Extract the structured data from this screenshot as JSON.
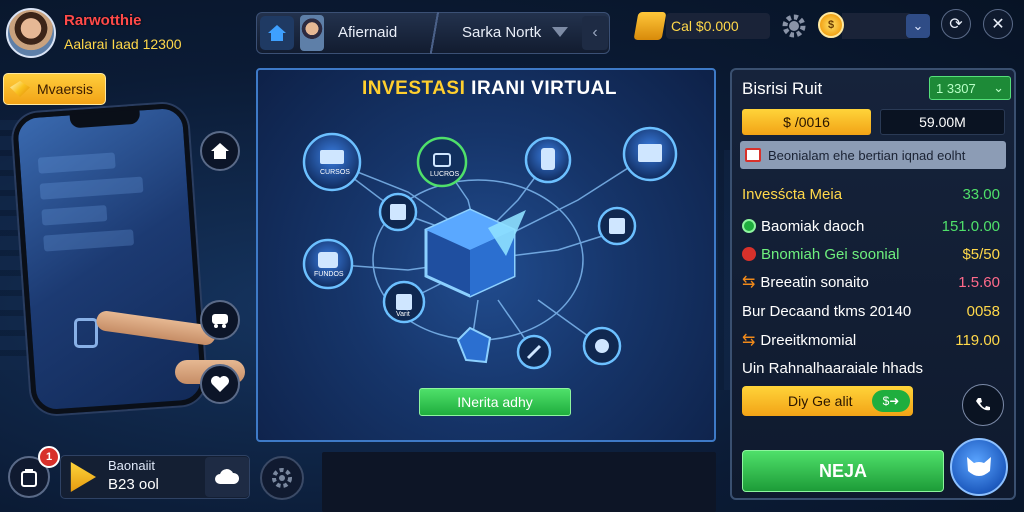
{
  "profile": {
    "name": "Rarwotthie",
    "sub": "Aalarai Iaad 12300"
  },
  "view_button": {
    "label": "Mvaersis"
  },
  "nav": {
    "tab1": "Afiernaid",
    "tab2": "Sarka Nortk"
  },
  "balance": {
    "label": "Cal $0.000"
  },
  "main": {
    "title_yellow": "INVESTASI",
    "title_white": "IRANI VIRTUAL",
    "nodes": {
      "n1": "CURSOS",
      "n2": "LUCROS",
      "n3": "FUNDOS",
      "center": "Varit"
    },
    "cta": "INerita adhy"
  },
  "right": {
    "title": "Bisrisi Ruit",
    "tag": "1 3307",
    "value_yellow": "$ /0016",
    "value_dark": "59.00M",
    "note": "Beonialam ehe bertian iqnad eolht",
    "rows": [
      {
        "label": "Invesścta Meia",
        "value": "33.00",
        "lcolor": "#ffd84a",
        "vcolor": "#4fe06a",
        "icon": "none"
      },
      {
        "label": "Baomiak daoch",
        "value": "151.0.00",
        "lcolor": "#ffffff",
        "vcolor": "#4fe06a",
        "icon": "green"
      },
      {
        "label": "Bnomiah Gei soonial",
        "value": "$5/50",
        "lcolor": "#6ef07e",
        "vcolor": "#ffd84a",
        "icon": "red"
      },
      {
        "label": "Breeatin sonaito",
        "value": "1.5.60",
        "lcolor": "#ffffff",
        "vcolor": "#ff6a8a",
        "icon": "orange"
      },
      {
        "label": "Bur Decaand tkms 20140",
        "value": "0058",
        "lcolor": "#ffffff",
        "vcolor": "#ffd84a",
        "icon": "none"
      },
      {
        "label": "Dreeitkmomial",
        "value": "119.00",
        "lcolor": "#ffffff",
        "vcolor": "#ffd84a",
        "icon": "orange"
      },
      {
        "label": "Uin Rahnalhaaraiale hhads",
        "value": "",
        "lcolor": "#ffffff",
        "vcolor": "#ffffff",
        "icon": "none"
      }
    ],
    "yellow_button": "Diy Ge alit",
    "green_button": "NEJA"
  },
  "bottom": {
    "badge": "1",
    "line1": "Baonaiit",
    "line2": "B23 ool"
  }
}
